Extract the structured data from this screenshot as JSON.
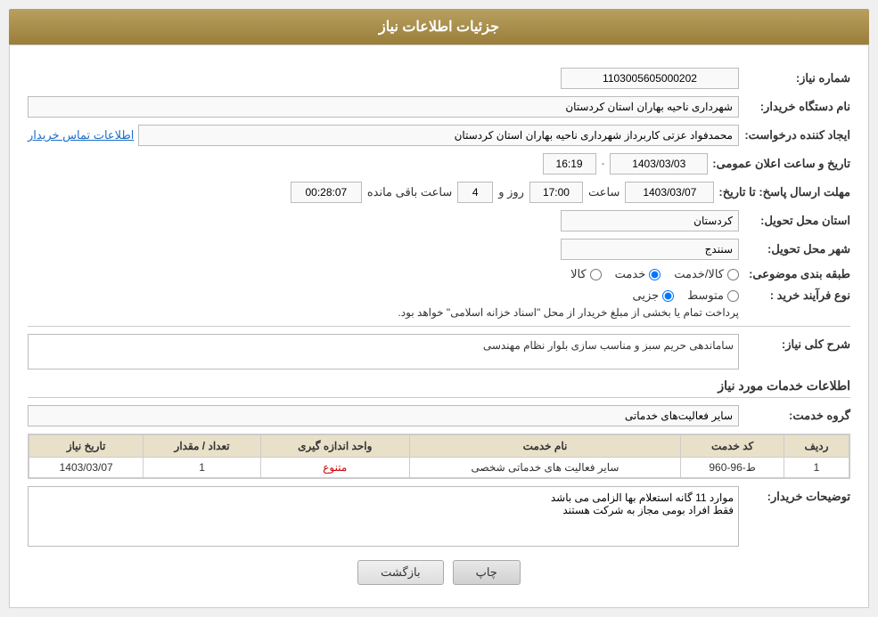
{
  "header": {
    "title": "جزئیات اطلاعات نیاز"
  },
  "form": {
    "need_number_label": "شماره نیاز:",
    "need_number_value": "1103005605000202",
    "buyer_org_label": "نام دستگاه خریدار:",
    "buyer_org_value": "شهرداری ناحیه بهاران استان کردستان",
    "creator_label": "ایجاد کننده درخواست:",
    "creator_value": "محمدفواد عزتی کاربرداز شهرداری ناحیه بهاران استان کردستان",
    "contact_link": "اطلاعات تماس خریدار",
    "announce_datetime_label": "تاریخ و ساعت اعلان عمومی:",
    "announce_date": "1403/03/03",
    "announce_time": "16:19",
    "response_deadline_label": "مهلت ارسال پاسخ: تا تاریخ:",
    "deadline_date": "1403/03/07",
    "deadline_time_label": "ساعت",
    "deadline_time": "17:00",
    "deadline_days_label": "روز و",
    "deadline_days": "4",
    "remaining_label": "ساعت باقی مانده",
    "remaining_time": "00:28:07",
    "province_label": "استان محل تحویل:",
    "province_value": "کردستان",
    "city_label": "شهر محل تحویل:",
    "city_value": "سنندج",
    "category_label": "طبقه بندی موضوعی:",
    "category_options": [
      {
        "label": "کالا",
        "value": "kala"
      },
      {
        "label": "خدمت",
        "value": "khedmat"
      },
      {
        "label": "کالا/خدمت",
        "value": "kala_khedmat"
      }
    ],
    "category_selected": "khedmat",
    "purchase_type_label": "نوع فرآیند خرید :",
    "purchase_type_note": "پرداخت تمام یا بخشی از مبلغ خریدار از محل \"اسناد خزانه اسلامی\" خواهد بود.",
    "purchase_options": [
      {
        "label": "جزیی",
        "value": "jozei"
      },
      {
        "label": "متوسط",
        "value": "motavaset"
      }
    ],
    "purchase_selected": "jozei",
    "need_desc_label": "شرح کلی نیاز:",
    "need_desc_value": "ساماندهی حریم سبز و مناسب سازی بلوار نظام مهندسی",
    "services_section_title": "اطلاعات خدمات مورد نیاز",
    "service_group_label": "گروه خدمت:",
    "service_group_value": "سایر فعالیت‌های خدماتی",
    "table": {
      "headers": [
        "ردیف",
        "کد خدمت",
        "نام خدمت",
        "واحد اندازه گیری",
        "تعداد / مقدار",
        "تاریخ نیاز"
      ],
      "rows": [
        {
          "row": "1",
          "code": "ط-96-960",
          "name": "سایر فعالیت های خدماتی شخصی",
          "unit": "متنوع",
          "qty": "1",
          "date": "1403/03/07"
        }
      ]
    },
    "buyer_desc_label": "توضیحات خریدار:",
    "buyer_desc_value": "موارد 11 گانه استعلام بها الزامی می باشد\nفقط افراد بومی مجاز به شرکت هستند",
    "btn_print": "چاپ",
    "btn_back": "بازگشت"
  }
}
